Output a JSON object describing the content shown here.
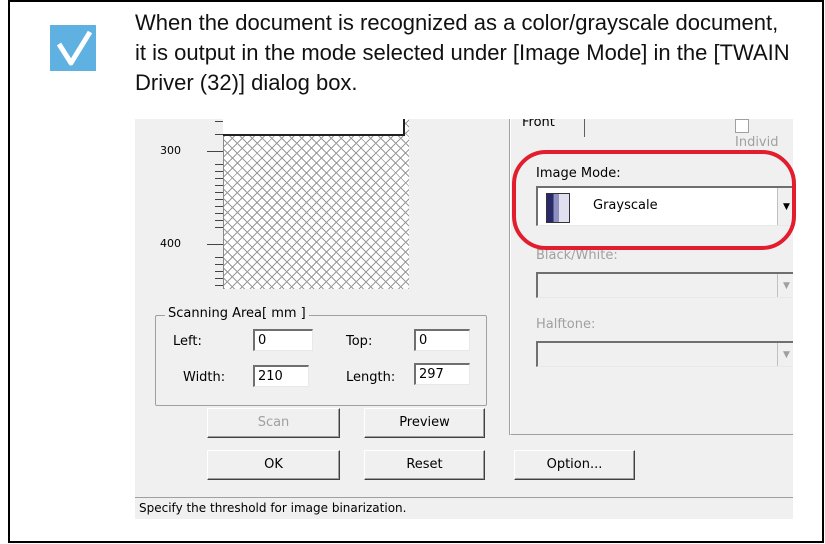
{
  "note": {
    "icon": "checkmark-icon",
    "text": "When the document is recognized as a color/grayscale document, it is output in the mode selected under [Image Mode] in the [TWAIN Driver (32)] dialog box."
  },
  "dialog": {
    "ruler_labels": [
      "300",
      "400"
    ],
    "tab_label": "Front",
    "individual_label": "Individ",
    "scanning_area": {
      "label": "Scanning Area[ mm ]",
      "left_label": "Left:",
      "left_value": "0",
      "top_label": "Top:",
      "top_value": "0",
      "width_label": "Width:",
      "width_value": "210",
      "length_label": "Length:",
      "length_value": "297"
    },
    "buttons": {
      "scan": "Scan",
      "preview": "Preview",
      "ok": "OK",
      "reset": "Reset",
      "option": "Option..."
    },
    "image_mode": {
      "label": "Image Mode:",
      "value": "Grayscale",
      "icon": "grayscale-icon"
    },
    "black_white_label": "Black/White:",
    "halftone_label": "Halftone:",
    "status": "Specify the threshold for image binarization.",
    "highlight_color": "#e21d2d"
  }
}
